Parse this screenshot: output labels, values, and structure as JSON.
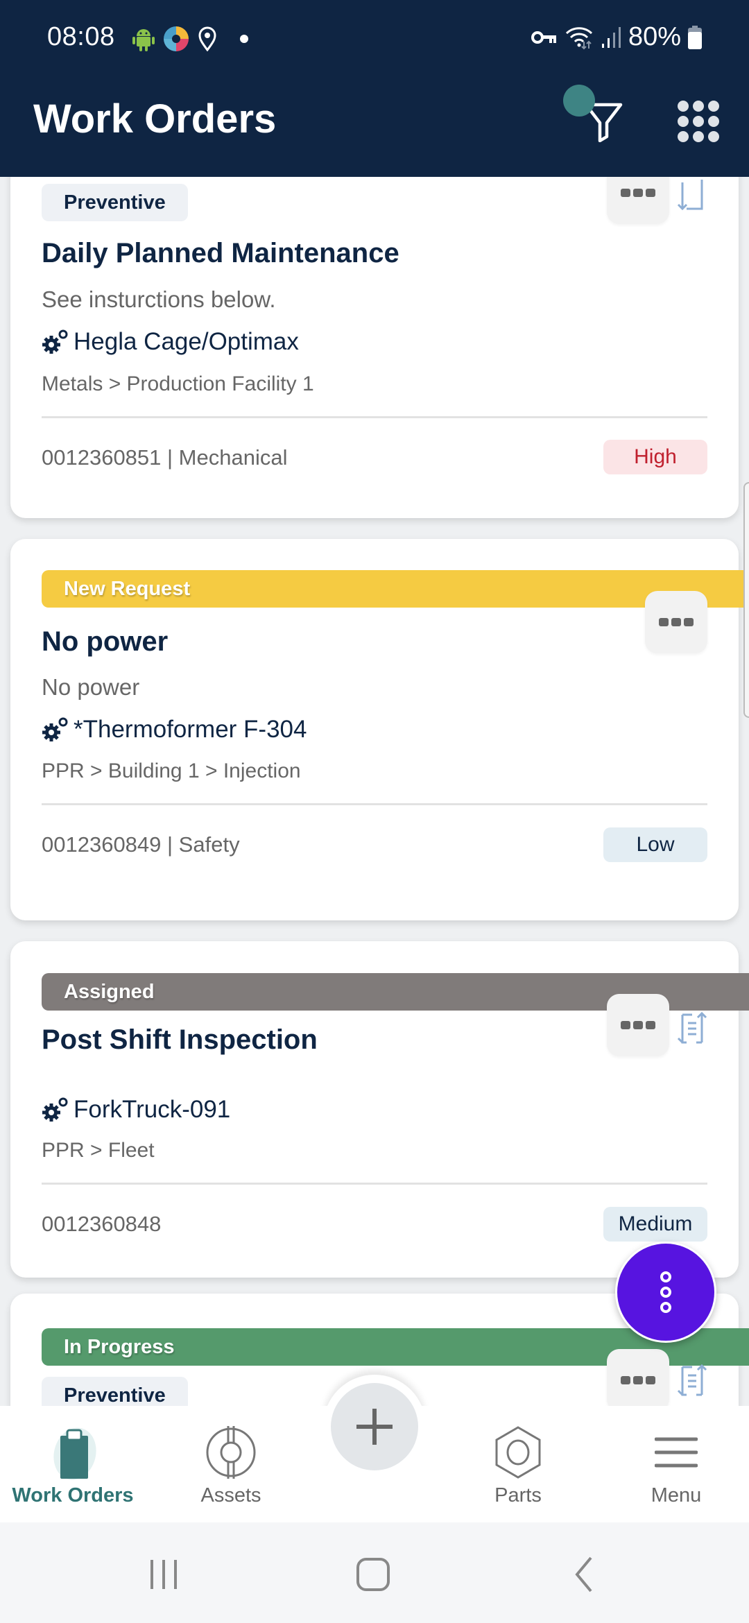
{
  "status_bar": {
    "time": "08:08",
    "battery": "80%",
    "left_icons": [
      "android-icon",
      "app-logo-icon",
      "location-icon",
      "notification-dot"
    ],
    "right_icons": [
      "vpn-key-icon",
      "wifi-icon",
      "signal-icon",
      "battery-icon"
    ]
  },
  "header": {
    "title": "Work Orders",
    "actions": [
      "filter-icon",
      "apps-grid-icon"
    ]
  },
  "colors": {
    "header_bg": "#0f2543",
    "accent_teal": "#2f7373",
    "fab": "#5714e0",
    "new_request": "#f5cb42",
    "assigned": "#807b7a",
    "in_progress": "#559a6c",
    "priority_high_bg": "#fbe4e6",
    "priority_high_text": "#c0202e",
    "priority_low_bg": "#e3edf3"
  },
  "work_orders": [
    {
      "status": "",
      "type": "Preventive",
      "title": "Daily Planned Maintenance",
      "description": "See insturctions below.",
      "asset": "Hegla Cage/Optimax",
      "location": "Metals > Production Facility 1",
      "meta": "0012360851 | Mechanical",
      "priority": "High"
    },
    {
      "status": "New Request",
      "type": "",
      "title": "No power",
      "description": "No power",
      "asset": "*Thermoformer F-304",
      "location": "PPR > Building 1 > Injection",
      "meta": "0012360849 | Safety",
      "priority": "Low"
    },
    {
      "status": "Assigned",
      "type": "",
      "title": "Post Shift Inspection",
      "description": "",
      "asset": "ForkTruck-091",
      "location": "PPR > Fleet",
      "meta": "0012360848",
      "priority": "Medium"
    },
    {
      "status": "In Progress",
      "type": "Preventive",
      "title": "",
      "description": "",
      "asset": "",
      "location": "",
      "meta": "",
      "priority": ""
    }
  ],
  "bottom_nav": {
    "items": [
      {
        "label": "Work Orders",
        "icon": "clipboard-icon",
        "active": true
      },
      {
        "label": "Assets",
        "icon": "assets-icon",
        "active": false
      },
      {
        "label": "Parts",
        "icon": "hex-nut-icon",
        "active": false
      },
      {
        "label": "Menu",
        "icon": "hamburger-icon",
        "active": false
      }
    ],
    "add_icon": "plus-icon"
  },
  "system_nav": [
    "recents-icon",
    "home-icon",
    "back-icon"
  ]
}
